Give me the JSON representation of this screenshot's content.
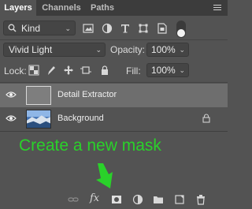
{
  "tabs": [
    {
      "label": "Layers",
      "active": true
    },
    {
      "label": "Channels",
      "active": false
    },
    {
      "label": "Paths",
      "active": false
    }
  ],
  "filter": {
    "kind_label": "Kind",
    "icons": [
      "image-filter-icon",
      "adjustment-filter-icon",
      "type-filter-icon",
      "shape-filter-icon",
      "smart-object-filter-icon"
    ]
  },
  "blend": {
    "mode": "Vivid Light",
    "opacity_label": "Opacity:",
    "opacity_value": "100%"
  },
  "lock": {
    "label": "Lock:",
    "icons": [
      "lock-transparent-pixels-icon",
      "lock-image-pixels-icon",
      "lock-position-icon",
      "lock-artboard-icon",
      "lock-all-icon"
    ],
    "fill_label": "Fill:",
    "fill_value": "100%"
  },
  "layers": [
    {
      "name": "Detail Extractor",
      "visible": true,
      "selected": true,
      "locked": false
    },
    {
      "name": "Background",
      "visible": true,
      "selected": false,
      "locked": true
    }
  ],
  "annotation": {
    "text": "Create a new mask",
    "color": "#2ad12a"
  },
  "bottom_bar": {
    "fx_label": "fx",
    "icons": [
      "link-layers-icon",
      "layer-style-icon",
      "add-layer-mask-icon",
      "adjustment-layer-icon",
      "new-group-icon",
      "new-layer-icon",
      "delete-layer-icon"
    ]
  },
  "colors": {
    "panel_bg": "#535353",
    "selected_row": "#6e6e6e",
    "tab_bar": "#3c3c3c"
  }
}
